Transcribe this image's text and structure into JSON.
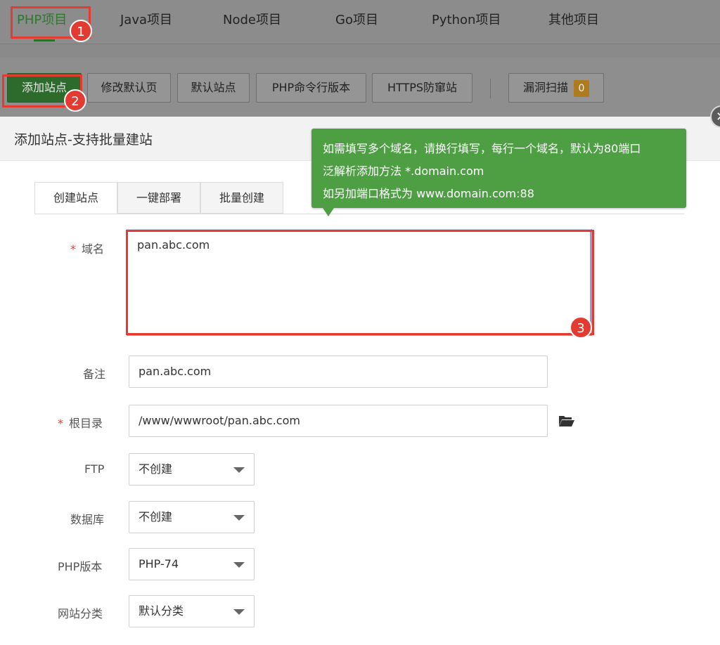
{
  "top_tabs": [
    {
      "label": "PHP项目",
      "active": true
    },
    {
      "label": "Java项目"
    },
    {
      "label": "Node项目"
    },
    {
      "label": "Go项目"
    },
    {
      "label": "Python项目"
    },
    {
      "label": "其他项目"
    }
  ],
  "toolbar": {
    "add_site": "添加站点",
    "edit_default_page": "修改默认页",
    "default_site": "默认站点",
    "php_cli_version": "PHP命令行版本",
    "https_anti_hijack": "HTTPS防窜站",
    "vuln_scan": "漏洞扫描",
    "vuln_count": "0"
  },
  "markers": [
    "1",
    "2",
    "3"
  ],
  "dialog": {
    "title": "添加站点-支持批量建站",
    "tabs": [
      "创建站点",
      "一键部署",
      "批量创建"
    ],
    "active_tab": "创建站点"
  },
  "tooltip": {
    "line1": "如需填写多个域名，请换行填写，每行一个域名，默认为80端口",
    "line2": "泛解析添加方法 *.domain.com",
    "line3": "如另加端口格式为 www.domain.com:88"
  },
  "form": {
    "domain": {
      "label": "域名",
      "required_mark": "*",
      "value": "pan.abc.com"
    },
    "remark": {
      "label": "备注",
      "value": "pan.abc.com"
    },
    "root": {
      "label": "根目录",
      "required_mark": "*",
      "value": "/www/wwwroot/pan.abc.com"
    },
    "ftp": {
      "label": "FTP",
      "value": "不创建"
    },
    "database": {
      "label": "数据库",
      "value": "不创建"
    },
    "php_version": {
      "label": "PHP版本",
      "value": "PHP-74"
    },
    "site_category": {
      "label": "网站分类",
      "value": "默认分类"
    }
  },
  "colors": {
    "accent_green": "#4e9f44",
    "marker_red": "#e33a32",
    "badge_orange": "#b07a1e"
  }
}
